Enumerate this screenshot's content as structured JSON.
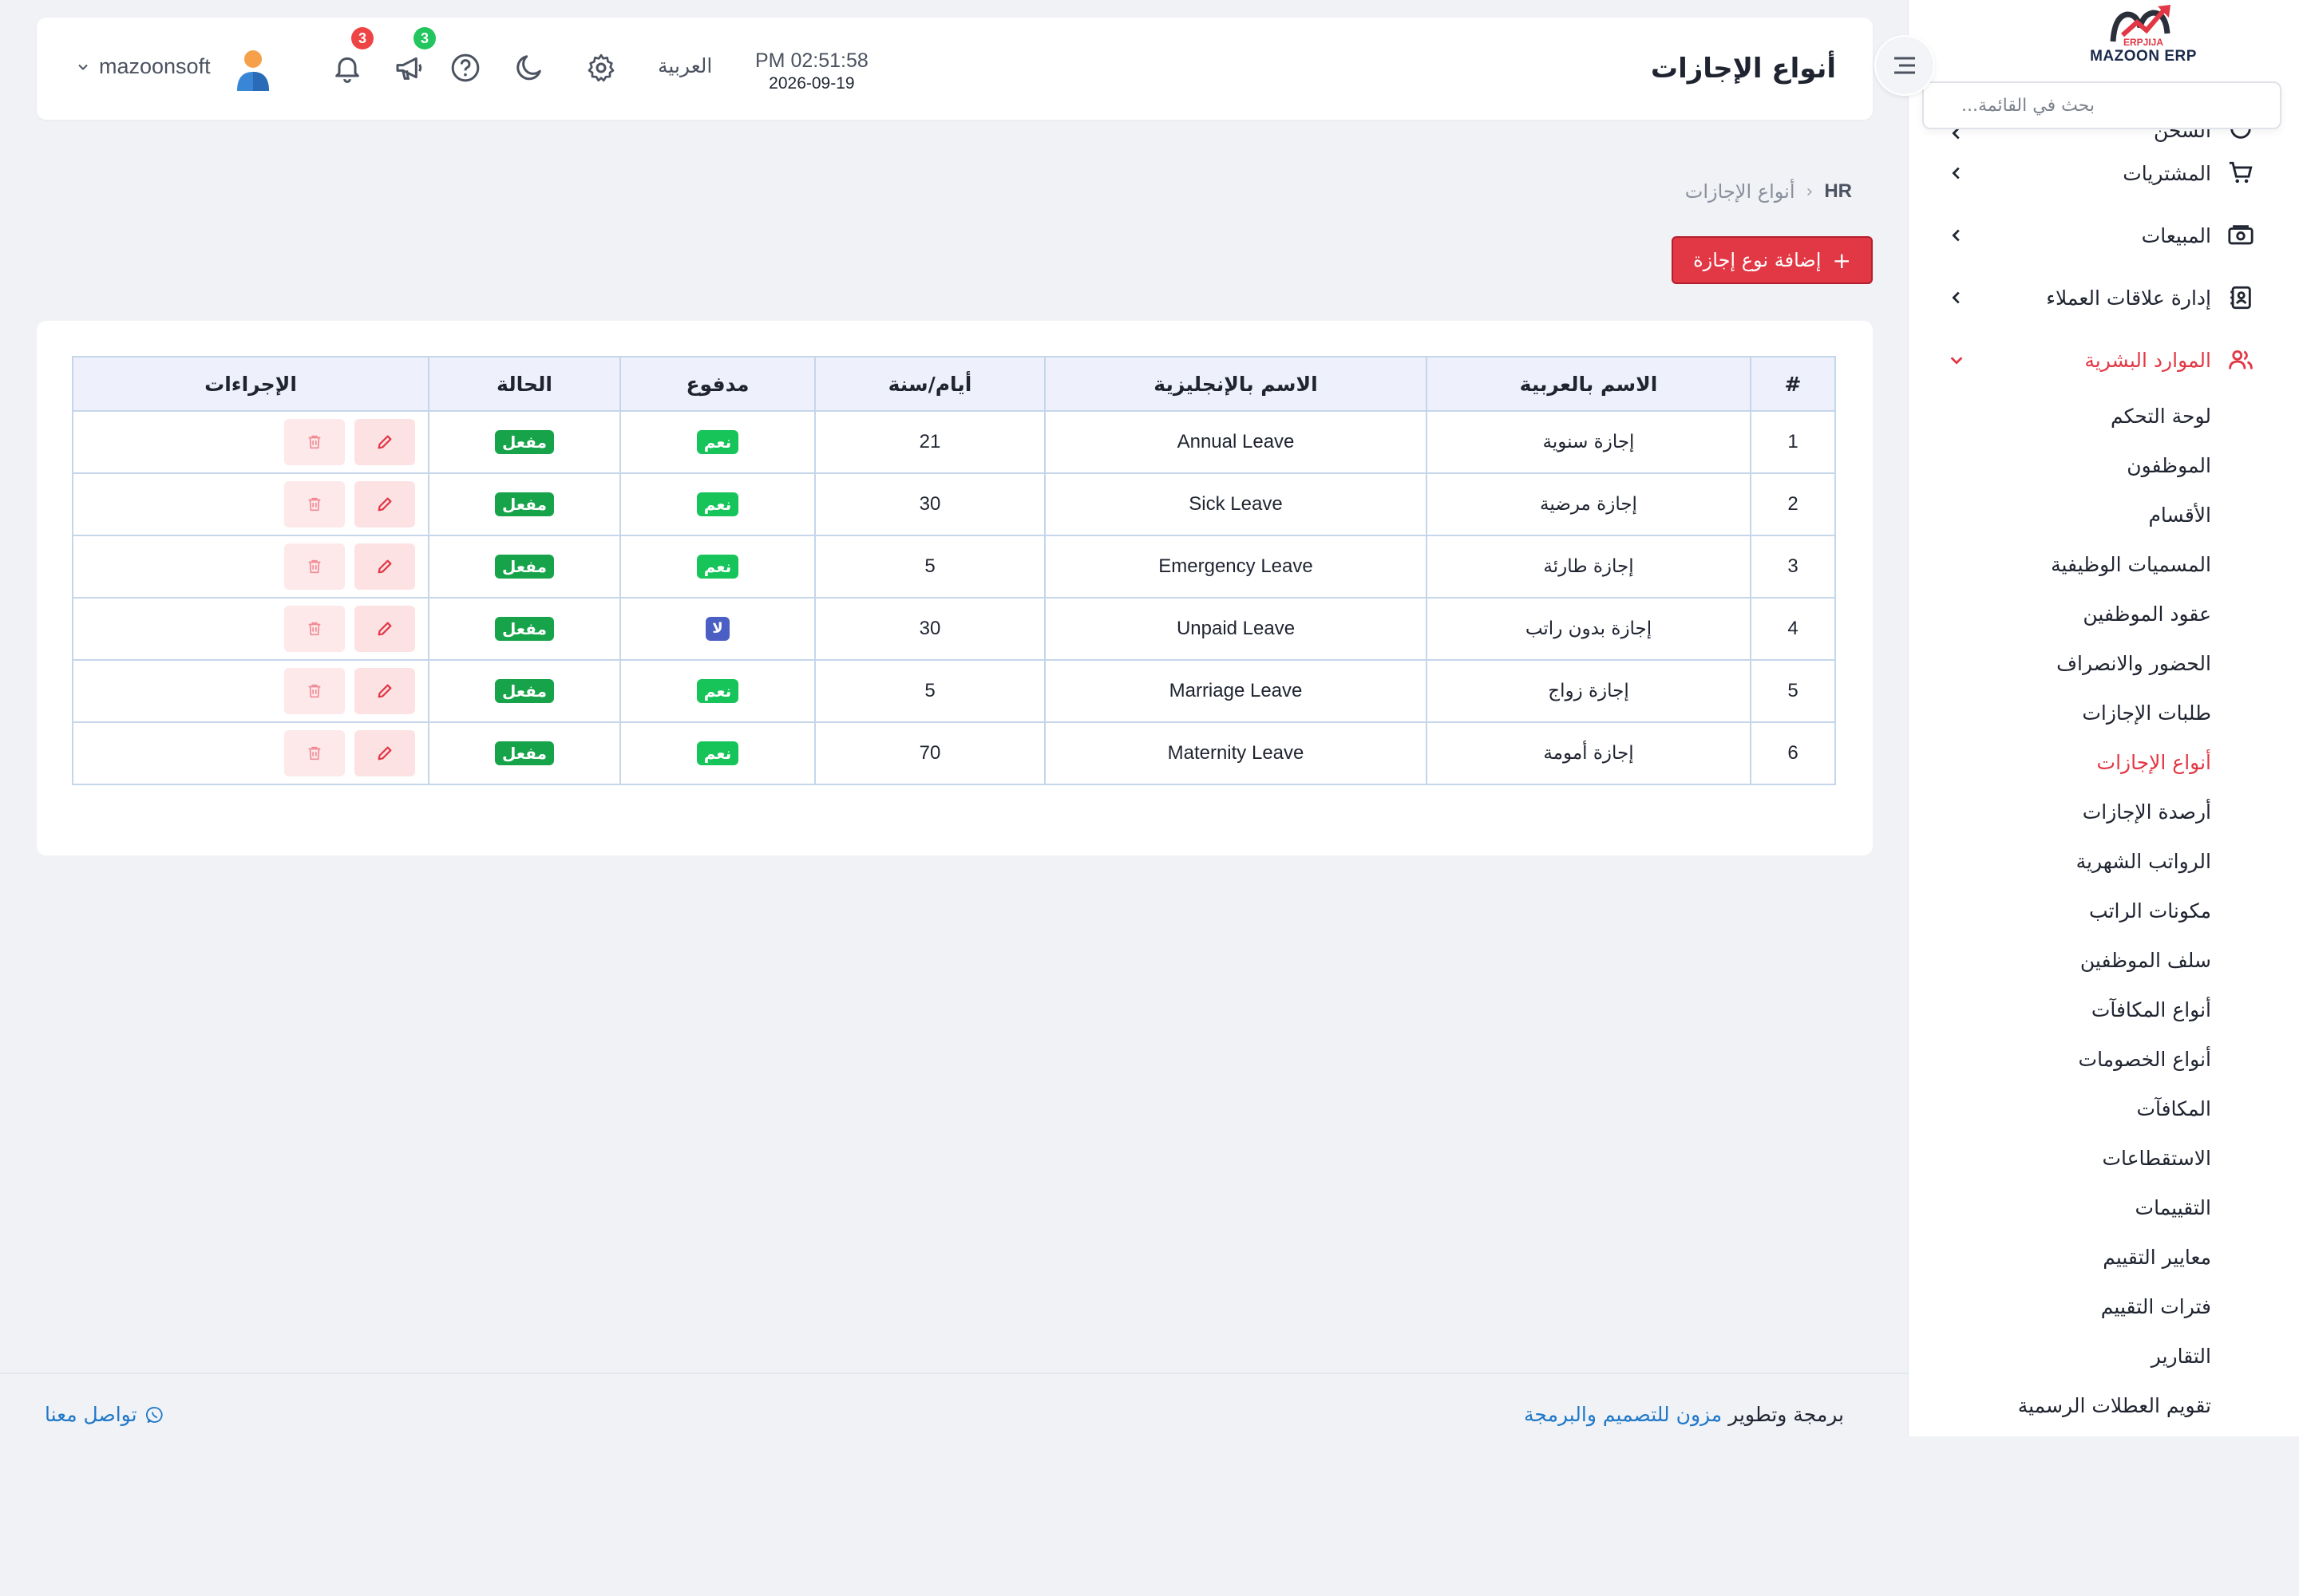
{
  "sidebar": {
    "logo_badge": "ERPJIJA",
    "logo_text": "MAZOON ERP",
    "search_placeholder": "بحث في القائمة...",
    "items": [
      {
        "label": "المشتريات",
        "icon": "cart-icon"
      },
      {
        "label": "المبيعات",
        "icon": "cash-icon"
      },
      {
        "label": "إدارة علاقات العملاء",
        "icon": "contacts-icon"
      },
      {
        "label": "الموارد البشرية",
        "icon": "users-icon"
      }
    ],
    "cut_item_label": "الشحن",
    "sub_items": [
      {
        "label": "لوحة التحكم"
      },
      {
        "label": "الموظفون"
      },
      {
        "label": "الأقسام"
      },
      {
        "label": "المسميات الوظيفية"
      },
      {
        "label": "عقود الموظفين"
      },
      {
        "label": "الحضور والانصراف"
      },
      {
        "label": "طلبات الإجازات"
      },
      {
        "label": "أنواع الإجازات"
      },
      {
        "label": "أرصدة الإجازات"
      },
      {
        "label": "الرواتب الشهرية"
      },
      {
        "label": "مكونات الراتب"
      },
      {
        "label": "سلف الموظفين"
      },
      {
        "label": "أنواع المكافآت"
      },
      {
        "label": "أنواع الخصومات"
      },
      {
        "label": "المكافآت"
      },
      {
        "label": "الاستقطاعات"
      },
      {
        "label": "التقييمات"
      },
      {
        "label": "معايير التقييم"
      },
      {
        "label": "فترات التقييم"
      },
      {
        "label": "التقارير"
      },
      {
        "label": "تقويم العطلات الرسمية"
      }
    ],
    "active_sub": "أنواع الإجازات"
  },
  "header": {
    "title": "أنواع الإجازات",
    "time": "PM 02:51:58",
    "date": "2026-09-19",
    "language": "العربية",
    "notifications_count": "3",
    "announcements_count": "3",
    "username": "mazoonsoft"
  },
  "breadcrumb": {
    "root": "HR",
    "separator": "‹",
    "current": "أنواع الإجازات"
  },
  "add_button_label": "إضافة نوع إجازة",
  "add_button_icon": "+",
  "table": {
    "headers": [
      "#",
      "الاسم بالعربية",
      "الاسم بالإنجليزية",
      "أيام/سنة",
      "مدفوع",
      "الحالة",
      "الإجراءات"
    ],
    "rows": [
      {
        "id": "1",
        "name_ar": "إجازة سنوية",
        "name_en": "Annual Leave",
        "days": "21",
        "paid": "نعم",
        "paid_flag": true,
        "status": "مفعل"
      },
      {
        "id": "2",
        "name_ar": "إجازة مرضية",
        "name_en": "Sick Leave",
        "days": "30",
        "paid": "نعم",
        "paid_flag": true,
        "status": "مفعل"
      },
      {
        "id": "3",
        "name_ar": "إجازة طارئة",
        "name_en": "Emergency Leave",
        "days": "5",
        "paid": "نعم",
        "paid_flag": true,
        "status": "مفعل"
      },
      {
        "id": "4",
        "name_ar": "إجازة بدون راتب",
        "name_en": "Unpaid Leave",
        "days": "30",
        "paid": "لا",
        "paid_flag": false,
        "status": "مفعل"
      },
      {
        "id": "5",
        "name_ar": "إجازة زواج",
        "name_en": "Marriage Leave",
        "days": "5",
        "paid": "نعم",
        "paid_flag": true,
        "status": "مفعل"
      },
      {
        "id": "6",
        "name_ar": "إجازة أمومة",
        "name_en": "Maternity Leave",
        "days": "70",
        "paid": "نعم",
        "paid_flag": true,
        "status": "مفعل"
      }
    ]
  },
  "footer": {
    "credit_prefix": "برمجة وتطوير",
    "credit_link": "مزون للتصميم والبرمجة",
    "contact": "تواصل معنا"
  },
  "colors": {
    "accent": "#e23744",
    "yes": "#16c45a",
    "no": "#4a5ec4",
    "enabled": "#16a34a",
    "link": "#1f78c8"
  }
}
